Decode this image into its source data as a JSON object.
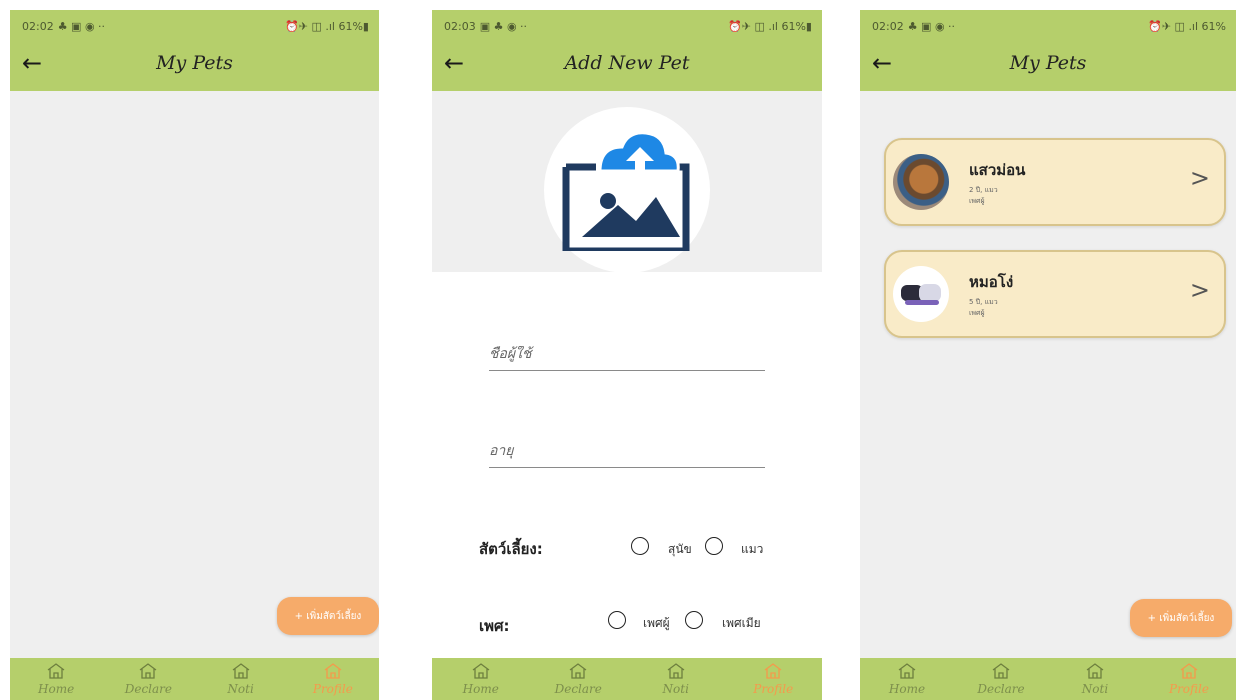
{
  "screens": [
    {
      "status": {
        "time": "02:02",
        "icons_left": "♣ ▣ ◉ ··",
        "icons_right": "⏰✈ ◫ .ıl 61%▮"
      },
      "title": "My Pets",
      "fab_label": "+ เพิ่มสัตว์เลี้ยง"
    },
    {
      "status": {
        "time": "02:03",
        "icons_left": "▣ ♣ ◉ ··",
        "icons_right": "⏰✈ ◫ .ıl 61%▮"
      },
      "title": "Add New Pet",
      "form": {
        "name_placeholder": "ชื่อผู้ใช้",
        "age_placeholder": "อายุ",
        "pet_type_label": "สัตว์เลี้ยง:",
        "pet_type_options": [
          "สุนัข",
          "แมว"
        ],
        "gender_label": "เพศ:",
        "gender_options": [
          "เพศผู้",
          "เพศเมีย"
        ]
      }
    },
    {
      "status": {
        "time": "02:02",
        "icons_left": "♣ ▣ ◉ ··",
        "icons_right": "⏰✈ ◫ .ıl 61%"
      },
      "title": "My Pets",
      "pets": [
        {
          "name": "แสวม่อน",
          "meta": "2 ปี, แมว",
          "gender": "เพศผู้"
        },
        {
          "name": "หมอโง่",
          "meta": "5 ปี, แมว",
          "gender": "เพศผู้"
        }
      ],
      "fab_label": "+ เพิ่มสัตว์เลี้ยง"
    }
  ],
  "nav": [
    {
      "label": "Home",
      "active": false
    },
    {
      "label": "Declare",
      "active": false
    },
    {
      "label": "Noti",
      "active": false
    },
    {
      "label": "Profile",
      "active": true
    }
  ],
  "colors": {
    "appbar": "#b5cf6b",
    "fab": "#f6ab6a",
    "card": "#f9ebc8",
    "active_nav": "#f59a4c"
  },
  "icons": {
    "back": "arrow-left-icon",
    "nav": "home-icon",
    "upload": "image-upload-icon",
    "card_chevron": "chevron-right-icon",
    "radio": "radio-circle-icon"
  }
}
